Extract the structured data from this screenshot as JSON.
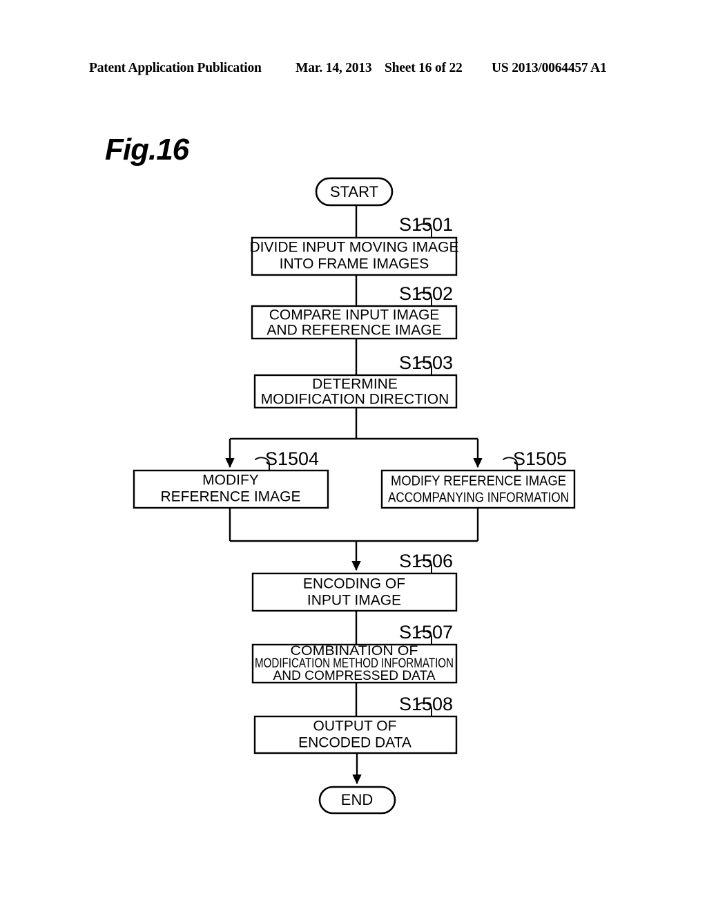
{
  "header": {
    "publication": "Patent Application Publication",
    "date": "Mar. 14, 2013",
    "sheet": "Sheet 16 of 22",
    "number": "US 2013/0064457 A1"
  },
  "figure": {
    "title": "Fig.16"
  },
  "flowchart": {
    "start_label": "START",
    "end_label": "END",
    "steps": [
      {
        "id": "S1501",
        "lines": [
          "DIVIDE INPUT MOVING IMAGE",
          "INTO FRAME IMAGES"
        ]
      },
      {
        "id": "S1502",
        "lines": [
          "COMPARE INPUT IMAGE",
          "AND REFERENCE IMAGE"
        ]
      },
      {
        "id": "S1503",
        "lines": [
          "DETERMINE",
          "MODIFICATION DIRECTION"
        ]
      },
      {
        "id": "S1504",
        "lines": [
          "MODIFY",
          "REFERENCE IMAGE"
        ]
      },
      {
        "id": "S1505",
        "lines": [
          "MODIFY REFERENCE IMAGE",
          "ACCOMPANYING INFORMATION"
        ]
      },
      {
        "id": "S1506",
        "lines": [
          "ENCODING OF",
          "INPUT IMAGE"
        ]
      },
      {
        "id": "S1507",
        "lines": [
          "COMBINATION OF",
          "MODIFICATION METHOD INFORMATION",
          "AND COMPRESSED DATA"
        ]
      },
      {
        "id": "S1508",
        "lines": [
          "OUTPUT OF",
          "ENCODED DATA"
        ]
      }
    ]
  },
  "colors": {
    "ink": "#000000",
    "paper": "#ffffff"
  }
}
